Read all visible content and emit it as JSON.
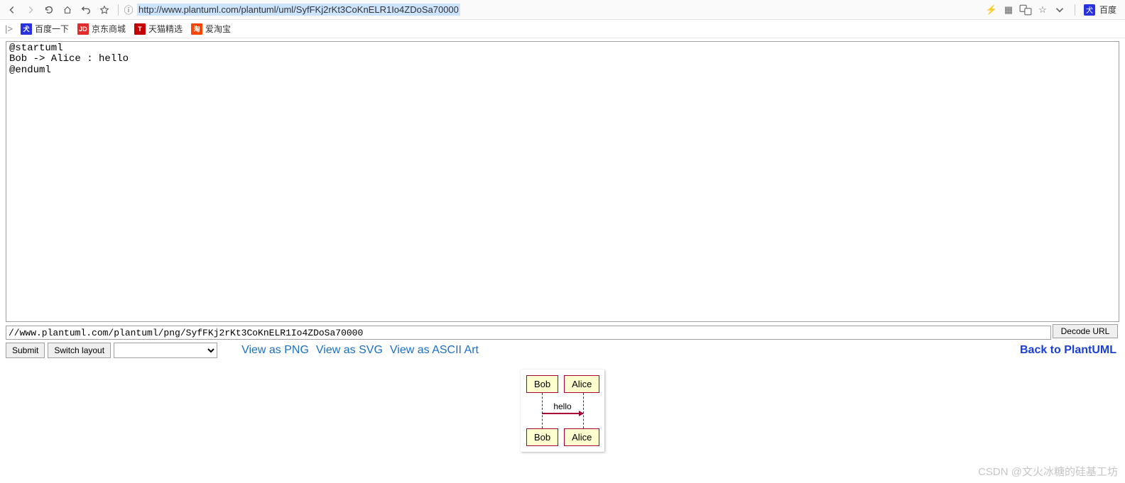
{
  "toolbar": {
    "url": "http://www.plantuml.com/plantuml/uml/SyfFKj2rKt3CoKnELR1Io4ZDoSa70000",
    "search_engine": "百度"
  },
  "bookmarks": {
    "items": [
      {
        "label": "百度一下",
        "icon": ""
      },
      {
        "label": "京东商城",
        "icon": "JD"
      },
      {
        "label": "天猫精选",
        "icon": "T"
      },
      {
        "label": "爱淘宝",
        "icon": "淘"
      }
    ]
  },
  "editor": {
    "code": "@startuml\nBob -> Alice : hello\n@enduml",
    "encoded_url": "//www.plantuml.com/plantuml/png/SyfFKj2rKt3CoKnELR1Io4ZDoSa70000"
  },
  "buttons": {
    "decode": "Decode URL",
    "submit": "Submit",
    "switch_layout": "Switch layout"
  },
  "links": {
    "view_png": "View as PNG",
    "view_svg": "View as SVG",
    "view_ascii": "View as ASCII Art",
    "back": "Back to PlantUML"
  },
  "diagram": {
    "participants": [
      "Bob",
      "Alice"
    ],
    "message": "hello"
  },
  "watermark": "CSDN @文火冰糖的硅基工坊"
}
